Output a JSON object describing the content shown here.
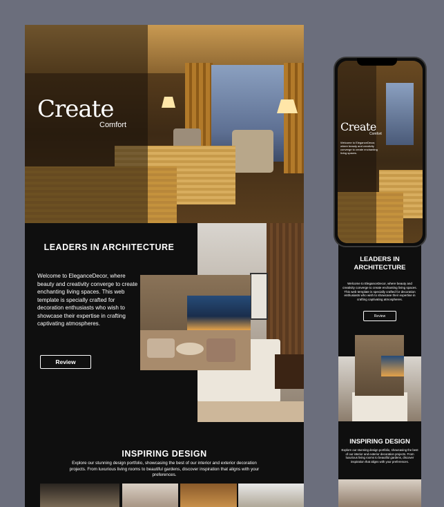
{
  "desktop": {
    "hero": {
      "title": "Create",
      "subtitle": "Comfort"
    },
    "about": {
      "title": "LEADERS IN ARCHITECTURE",
      "text": "Welcome to EleganceDecor, where beauty and creativity converge to create enchanting living spaces. This web template is specially crafted for decoration enthusiasts who wish to showcase their expertise in crafting captivating atmospheres.",
      "button_label": "Review"
    },
    "inspiring": {
      "title": "INSPIRING DESIGN",
      "text": "Explore our stunning design portfolio, showcasing the best of our interior and exterior decoration projects. From luxurious living rooms to beautiful gardens, discover inspiration that aligns with your preferences."
    }
  },
  "mobile": {
    "hero": {
      "title": "Create",
      "subtitle": "Comfort",
      "text": "Welcome to EleganceDecor, where beauty and creativity converge to create enchanting living spaces."
    },
    "about": {
      "title": "LEADERS IN ARCHITECTURE",
      "text": "Welcome to EleganceDecor, where beauty and creativity converge to create enchanting living spaces. This web template is specially crafted for decoration enthusiasts who wish to showcase their expertise in crafting captivating atmospheres.",
      "button_label": "Review"
    },
    "inspiring": {
      "title": "INSPIRING DESIGN",
      "text": "Explore our stunning design portfolio, showcasing the best of our interior and exterior decoration projects. From luxurious living rooms to beautiful gardens, discover inspiration that aligns with your preferences."
    }
  }
}
